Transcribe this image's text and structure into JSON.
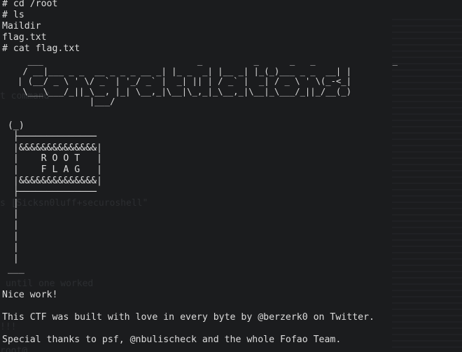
{
  "terminal": {
    "lines": {
      "cmd_cd": "# cd /root",
      "cmd_ls": "# ls",
      "out_maildir": "Maildir",
      "out_flag": "flag.txt",
      "cmd_cat": "# cat flag.txt"
    },
    "ascii_title": "     ___                              _          _      _   _               _\n    / __|___ _ _  __ _ _ _ __ _| |_ _  _| |__ _| |_(_)___ _ _  __| |\n   | (__/ _ \\ ' \\/ _` | '_/ _` |  _| || | / _` |  _| / _ \\ ' \\(_-<_|\n    \\___\\___/_||_\\__, |_| \\__,_|\\__|\\_,_|_\\__,_|\\__|_\\___/_||_/__(_)\n                 |___/",
    "ascii_gallows": " (_)\n  ├──────────────\n  |&&&&&&&&&&&&&&|\n  |    R O O T   |\n  |    F L A G   |\n  |&&&&&&&&&&&&&&|\n  ├──────────────\n  |\n  |\n  |\n  |\n  |\n  |\n ___",
    "nice_work": "Nice work!",
    "built_with_love": "This CTF was built with love in every byte by @berzerk0 on Twitter.",
    "special_thanks": "Special thanks to psf, @nbulischeck and the whole Fofao Team."
  },
  "ghost_text": {
    "pass": "s [Sicksn0luff+securoshell\"",
    "until": "until one worked",
    "block": "!!!",
    "root": "root@",
    "command": "t command"
  }
}
